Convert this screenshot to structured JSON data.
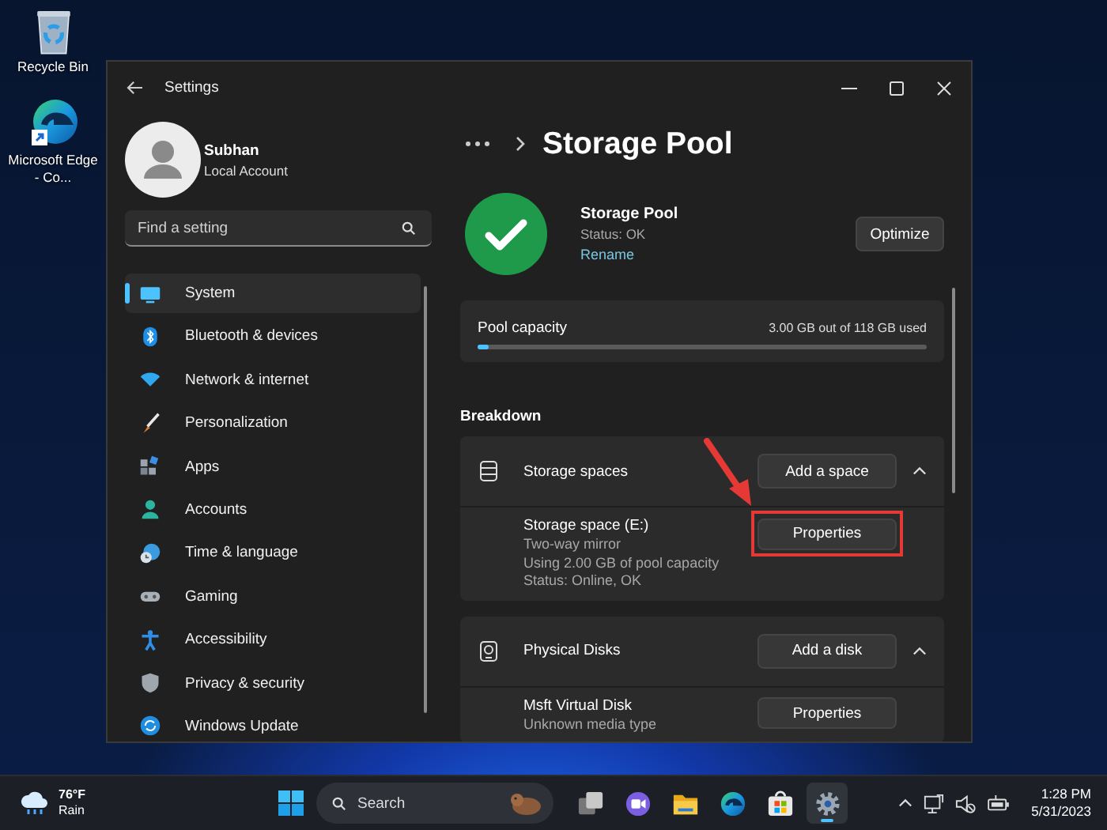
{
  "desktop_icons": [
    {
      "kind": "recycle-bin",
      "label": "Recycle Bin"
    },
    {
      "kind": "edge",
      "label": "Microsoft Edge - Co..."
    }
  ],
  "window": {
    "title": "Settings"
  },
  "profile": {
    "name": "Subhan",
    "account_type": "Local Account"
  },
  "search": {
    "placeholder": "Find a setting"
  },
  "nav_items": [
    {
      "kind": "system",
      "label": "System",
      "selected": true
    },
    {
      "kind": "bluetooth",
      "label": "Bluetooth & devices",
      "selected": false
    },
    {
      "kind": "network",
      "label": "Network & internet",
      "selected": false
    },
    {
      "kind": "personalization",
      "label": "Personalization",
      "selected": false
    },
    {
      "kind": "apps",
      "label": "Apps",
      "selected": false
    },
    {
      "kind": "accounts",
      "label": "Accounts",
      "selected": false
    },
    {
      "kind": "time",
      "label": "Time & language",
      "selected": false
    },
    {
      "kind": "gaming",
      "label": "Gaming",
      "selected": false
    },
    {
      "kind": "accessibility",
      "label": "Accessibility",
      "selected": false
    },
    {
      "kind": "privacy",
      "label": "Privacy & security",
      "selected": false
    },
    {
      "kind": "update",
      "label": "Windows Update",
      "selected": false
    }
  ],
  "page_title": "Storage Pool",
  "pool": {
    "name": "Storage Pool",
    "status": "Status: OK",
    "link": "Rename",
    "button": "Optimize"
  },
  "capacity": {
    "label": "Pool capacity",
    "reading": "3.00 GB out of 118 GB used",
    "level": 0.025
  },
  "breakdown": {
    "heading": "Breakdown",
    "sections": [
      {
        "kind": "spaces",
        "title": "Storage spaces",
        "action": "Add a space",
        "expanded": true,
        "items": [
          {
            "title": "Storage space (E:)",
            "details": [
              "Two-way mirror",
              "Using 2.00 GB of pool capacity",
              "Status: Online, OK"
            ],
            "button": "Properties",
            "highlighted": true
          }
        ]
      },
      {
        "kind": "disks",
        "title": "Physical Disks",
        "action": "Add a disk",
        "expanded": true,
        "items": [
          {
            "title": "Msft Virtual Disk",
            "details": [
              "Unknown media type"
            ],
            "button": "Properties",
            "highlighted": false
          }
        ]
      }
    ]
  },
  "taskbar": {
    "weather": {
      "temperature": "76°F",
      "condition": "Rain"
    },
    "search": {
      "placeholder": "Search"
    },
    "apps": [
      {
        "kind": "task-view",
        "active": false
      },
      {
        "kind": "chat",
        "active": false
      },
      {
        "kind": "file-explorer",
        "active": false
      },
      {
        "kind": "edge",
        "active": false
      },
      {
        "kind": "store",
        "active": false
      },
      {
        "kind": "settings",
        "active": true
      }
    ],
    "clock": {
      "time": "1:28 PM",
      "date": "5/31/2023"
    }
  }
}
